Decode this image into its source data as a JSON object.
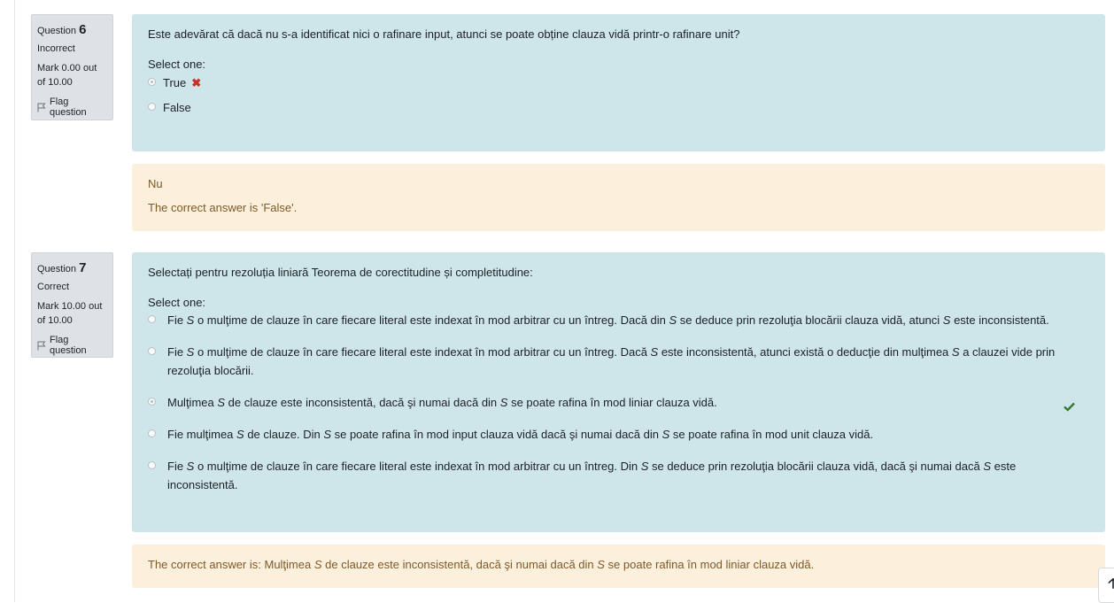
{
  "q6": {
    "info": {
      "label": "Question",
      "number": "6",
      "state": "Incorrect",
      "grade": "Mark 0.00 out of 10.00",
      "flag": "Flag question"
    },
    "text": "Este adevărat că dacă nu s-a identificat nici o rafinare input, atunci se poate obține clauza vidă printr-o rafinare unit?",
    "prompt": "Select one:",
    "answers": [
      {
        "label": "True",
        "selected": true,
        "mark": "incorrect"
      },
      {
        "label": "False",
        "selected": false
      }
    ],
    "feedback": "Nu",
    "right_answer": "The correct answer is 'False'."
  },
  "q7": {
    "info": {
      "label": "Question",
      "number": "7",
      "state": "Correct",
      "grade": "Mark 10.00 out of 10.00",
      "flag": "Flag question"
    },
    "text": "Selectați pentru rezoluția liniară Teorema de corectitudine și completitudine:",
    "prompt": "Select one:",
    "answers": [
      {
        "parts": [
          "Fie ",
          "S",
          " o mulţime de clauze în care fiecare literal este indexat în mod arbitrar cu un întreg. Dacă din ",
          "S",
          " se deduce prin rezoluţia blocării clauza vidă, atunci ",
          "S",
          " este inconsistentă."
        ],
        "selected": false
      },
      {
        "parts": [
          "Fie ",
          "S",
          " o mulţime de clauze în care fiecare literal este indexat în mod arbitrar cu un întreg. Dacă ",
          "S",
          " este inconsistentă, atunci există o deducţie din mulţimea ",
          "S",
          " a clauzei vide prin rezoluţia blocării."
        ],
        "selected": false
      },
      {
        "parts": [
          "Mulţimea ",
          "S",
          " de clauze este inconsistentă, dacă şi numai dacă din ",
          "S",
          " se poate rafina în mod liniar clauza vidă."
        ],
        "selected": true,
        "mark": "correct"
      },
      {
        "parts": [
          "Fie mulţimea ",
          "S",
          " de clauze. Din ",
          "S",
          " se poate rafina în mod input clauza vidă dacă şi numai dacă din ",
          "S",
          " se poate rafina în mod unit clauza vidă."
        ],
        "selected": false
      },
      {
        "parts": [
          "Fie ",
          "S",
          " o mulţime de clauze în care fiecare literal este indexat în mod arbitrar cu un întreg. Din ",
          "S",
          " se deduce prin rezoluţia blocării clauza vidă, dacă şi numai dacă ",
          "S",
          " este inconsistentă."
        ],
        "selected": false
      }
    ],
    "right_answer_parts": [
      "The correct answer is: Mulţimea ",
      "S",
      " de clauze este inconsistentă, dacă şi numai dacă din ",
      "S",
      " se poate rafina în mod liniar clauza vidă."
    ]
  },
  "icons": {
    "flag": "flag-icon",
    "incorrect": "cross-icon",
    "correct": "check-icon",
    "scroll_top": "arrow-up-icon"
  },
  "colors": {
    "formulation_bg": "#cee5ea",
    "outcome_bg": "#fcefdc",
    "outcome_text": "#7d5a29",
    "incorrect": "#ca3120",
    "correct": "#357a32"
  }
}
